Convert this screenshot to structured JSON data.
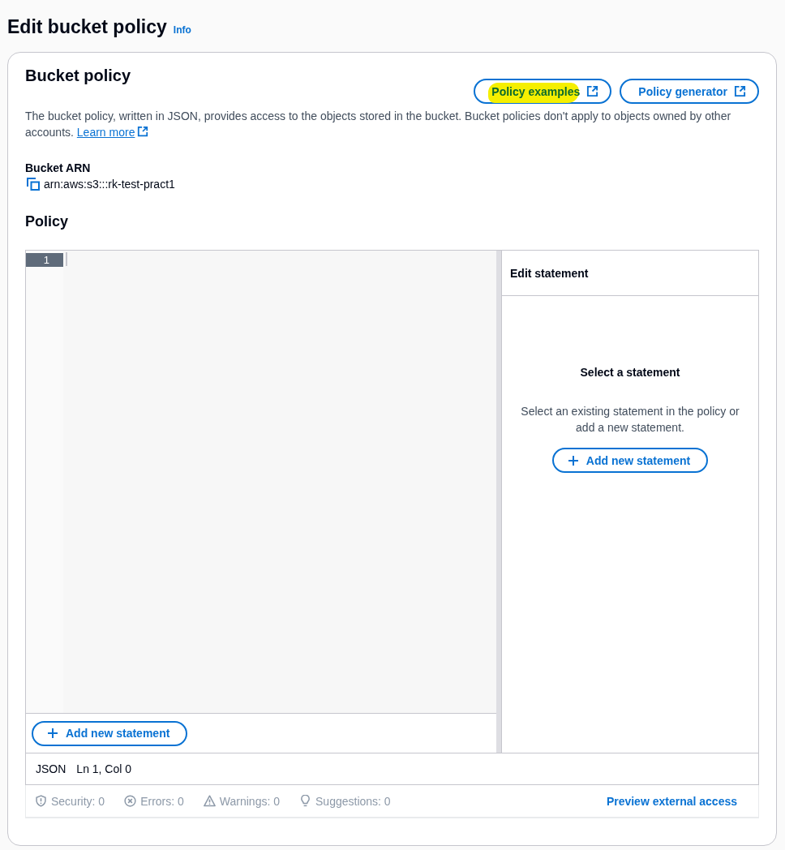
{
  "page": {
    "title": "Edit bucket policy",
    "info_link": "Info"
  },
  "card": {
    "title": "Bucket policy",
    "examples_button": {
      "label": "Policy examples",
      "highlighted": true
    },
    "generator_button": {
      "label": "Policy generator",
      "highlighted": false
    },
    "description": "The bucket policy, written in JSON, provides access to the objects stored in the bucket. Bucket policies don't apply to objects owned by other accounts.",
    "learn_more": "Learn more"
  },
  "bucket_arn": {
    "label": "Bucket ARN",
    "value": "arn:aws:s3:::rk-test-pract1"
  },
  "policy": {
    "title": "Policy",
    "editor": {
      "line_numbers": [
        "1"
      ],
      "add_button": "Add new statement"
    },
    "side_panel": {
      "title": "Edit statement",
      "empty_title": "Select a statement",
      "empty_text": "Select an existing statement in the policy or add a new statement.",
      "add_button": "Add new statement"
    },
    "status": {
      "language": "JSON",
      "cursor": "Ln 1, Col 0"
    },
    "checks": [
      {
        "kind": "security",
        "label": "Security: 0"
      },
      {
        "kind": "errors",
        "label": "Errors: 0"
      },
      {
        "kind": "warnings",
        "label": "Warnings: 0"
      },
      {
        "kind": "suggestions",
        "label": "Suggestions: 0"
      }
    ],
    "preview_link": "Preview external access"
  }
}
